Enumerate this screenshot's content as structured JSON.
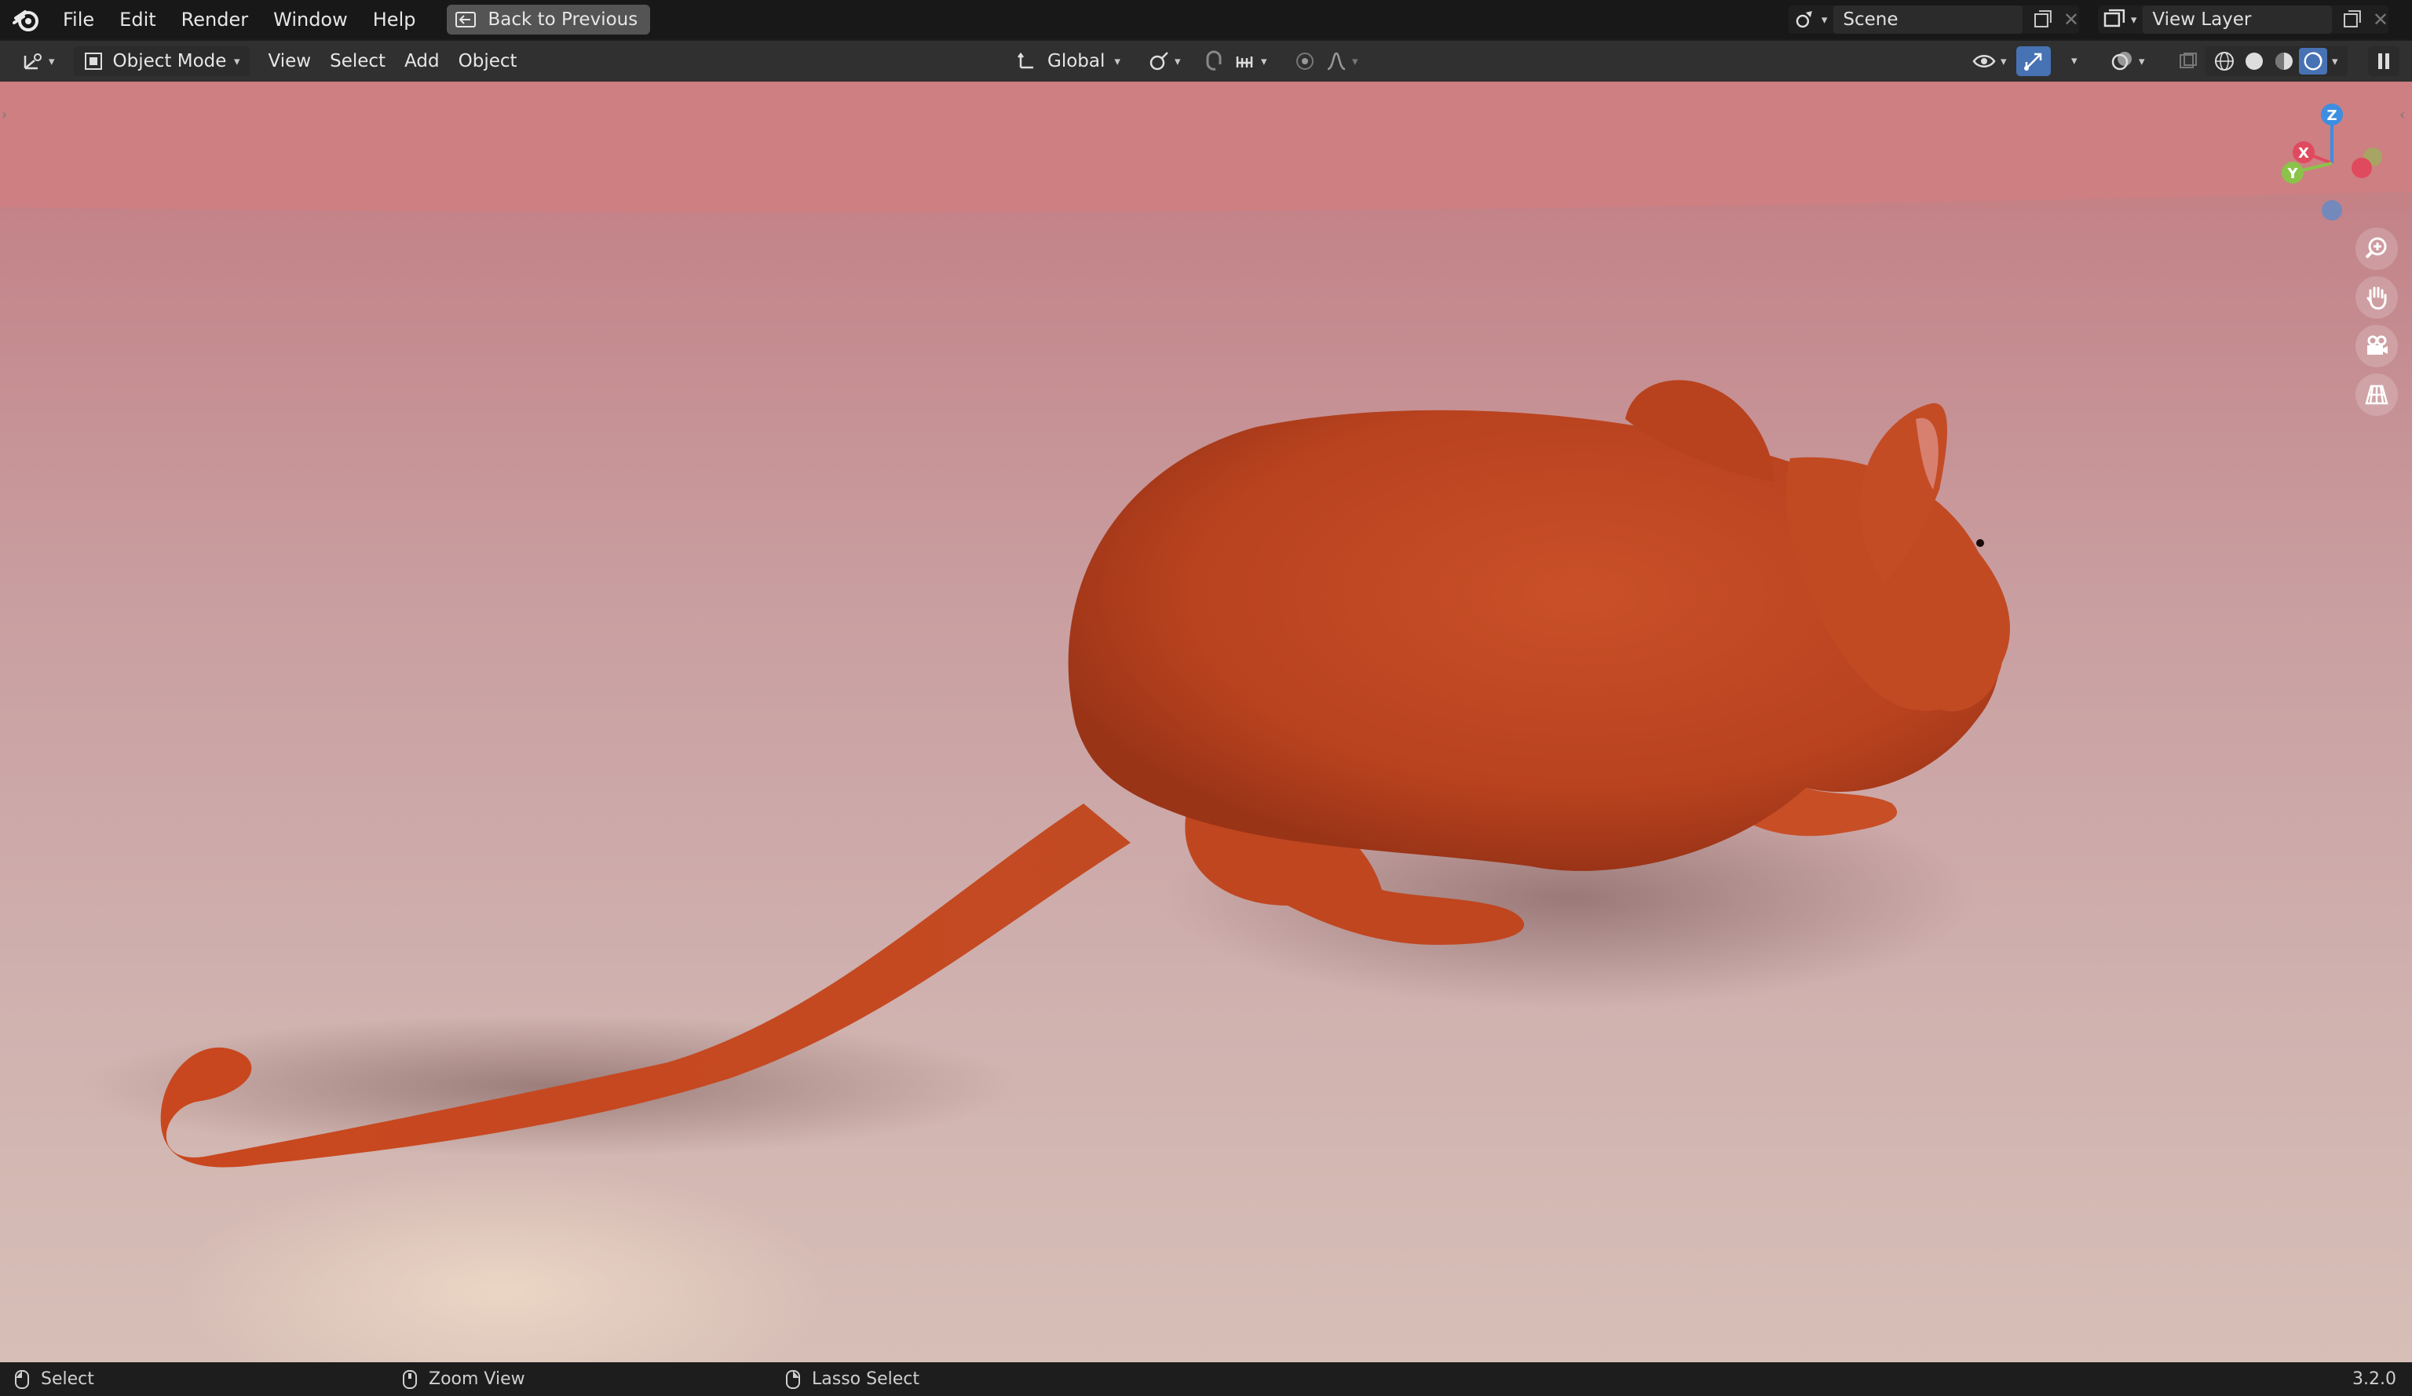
{
  "menubar": {
    "items": [
      "File",
      "Edit",
      "Render",
      "Window",
      "Help"
    ],
    "back_button": "Back to Previous"
  },
  "scene": {
    "label": "Scene"
  },
  "view_layer": {
    "label": "View Layer"
  },
  "header": {
    "mode": "Object Mode",
    "menus": [
      "View",
      "Select",
      "Add",
      "Object"
    ],
    "orientation": "Global"
  },
  "gizmo": {
    "x": "X",
    "y": "Y",
    "z": "Z"
  },
  "statusbar": {
    "left": "Select",
    "middle": "Zoom View",
    "right": "Lasso Select",
    "version": "3.2.0"
  },
  "colors": {
    "accent": "#4772b3",
    "axis_x": "#e04a5e",
    "axis_y": "#8bc34a",
    "axis_z": "#3d8ee0"
  }
}
